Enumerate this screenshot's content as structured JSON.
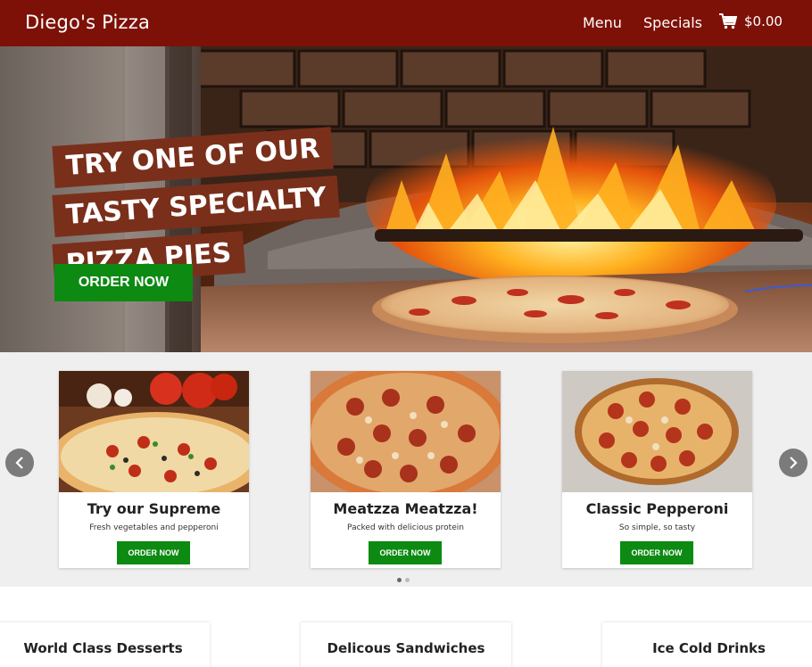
{
  "navbar": {
    "brand": "Diego's Pizza",
    "links": [
      "Menu",
      "Specials"
    ],
    "cart_total": "$0.00",
    "cart_icon": "shopping-cart-icon"
  },
  "hero": {
    "lines": [
      "TRY ONE OF OUR",
      "TASTY SPECIALTY",
      "PIZZA PIES"
    ],
    "button_label": "ORDER NOW"
  },
  "carousel": {
    "cards": [
      {
        "title": "Try our Supreme",
        "subtitle": "Fresh vegetables and pepperoni",
        "button_label": "ORDER NOW"
      },
      {
        "title": "Meatzza Meatzza!",
        "subtitle": "Packed with delicious protein",
        "button_label": "ORDER NOW"
      },
      {
        "title": "Classic Pepperoni",
        "subtitle": "So simple, so tasty",
        "button_label": "ORDER NOW"
      }
    ],
    "prev_icon": "chevron-left-icon",
    "next_icon": "chevron-right-icon"
  },
  "features": [
    "World Class Desserts",
    "Delicous Sandwiches",
    "Ice Cold Drinks"
  ],
  "colors": {
    "navbar": "#7d1107",
    "button_green": "#0c8a12",
    "hero_banner": "#7a2f1a",
    "carousel_bg": "#efefef"
  }
}
